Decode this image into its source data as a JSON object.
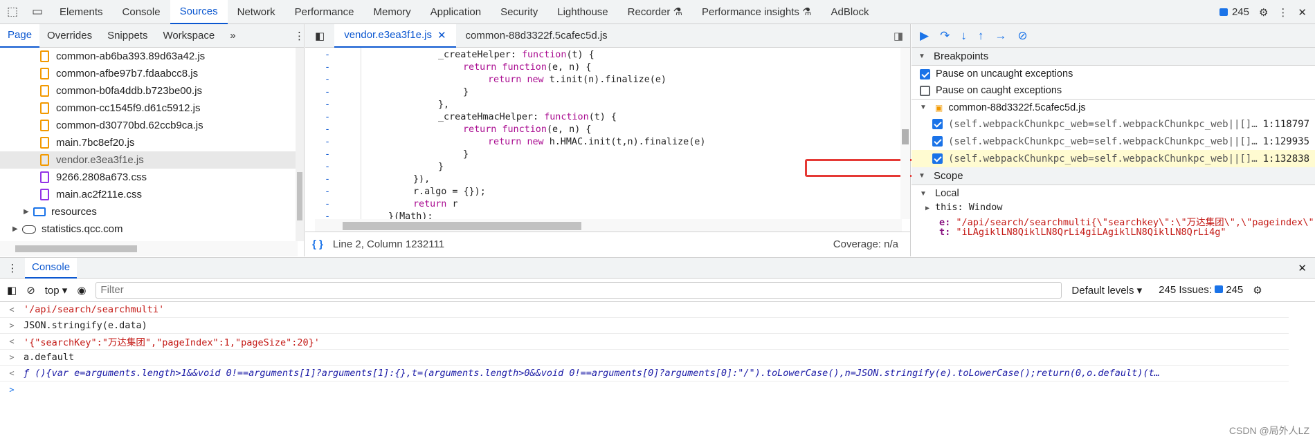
{
  "topbar": {
    "tabs": [
      "Elements",
      "Console",
      "Sources",
      "Network",
      "Performance",
      "Memory",
      "Application",
      "Security",
      "Lighthouse",
      "Recorder ⚗",
      "Performance insights ⚗",
      "AdBlock"
    ],
    "active_tab": "Sources",
    "issues_count": "245"
  },
  "navigator": {
    "subtabs": [
      "Page",
      "Overrides",
      "Snippets",
      "Workspace"
    ],
    "files": [
      {
        "name": "common-ab6ba393.89d63a42.js",
        "type": "js"
      },
      {
        "name": "common-afbe97b7.fdaabcc8.js",
        "type": "js"
      },
      {
        "name": "common-b0fa4ddb.b723be00.js",
        "type": "js"
      },
      {
        "name": "common-cc1545f9.d61c5912.js",
        "type": "js"
      },
      {
        "name": "common-d30770bd.62ccb9ca.js",
        "type": "js"
      },
      {
        "name": "main.7bc8ef20.js",
        "type": "js"
      },
      {
        "name": "vendor.e3ea3f1e.js",
        "type": "js",
        "selected": true
      },
      {
        "name": "9266.2808a673.css",
        "type": "css"
      },
      {
        "name": "main.ac2f211e.css",
        "type": "css"
      }
    ],
    "folder_resources": "resources",
    "domain_statistics": "statistics.qcc.com"
  },
  "editor": {
    "tabs": [
      {
        "label": "vendor.e3ea3f1e.js",
        "active": true
      },
      {
        "label": "common-88d3322f.5cafec5d.js",
        "active": false
      }
    ],
    "lines": [
      {
        "gut": "-",
        "ind": 8,
        "parts": [
          [
            "_createHelper: ",
            "fn"
          ],
          [
            "function",
            "kw"
          ],
          [
            "(t) {",
            "fn"
          ]
        ]
      },
      {
        "gut": "-",
        "ind": 12,
        "parts": [
          [
            "return ",
            "kw"
          ],
          [
            "function",
            "kw"
          ],
          [
            "(e, n) {",
            "fn"
          ]
        ]
      },
      {
        "gut": "-",
        "ind": 16,
        "parts": [
          [
            "return ",
            "kw"
          ],
          [
            "new ",
            "kw"
          ],
          [
            "t.init(n).finalize(e)",
            "fn"
          ]
        ]
      },
      {
        "gut": "-",
        "ind": 12,
        "parts": [
          [
            "}",
            "fn"
          ]
        ]
      },
      {
        "gut": "-",
        "ind": 8,
        "parts": [
          [
            "},",
            "fn"
          ]
        ]
      },
      {
        "gut": "-",
        "ind": 8,
        "parts": [
          [
            "_createHmacHelper: ",
            "fn"
          ],
          [
            "function",
            "kw"
          ],
          [
            "(t) {",
            "fn"
          ]
        ]
      },
      {
        "gut": "-",
        "ind": 12,
        "parts": [
          [
            "return ",
            "kw"
          ],
          [
            "function",
            "kw"
          ],
          [
            "(e, n) {",
            "fn"
          ]
        ]
      },
      {
        "gut": "-",
        "ind": 16,
        "parts": [
          [
            "return ",
            "kw"
          ],
          [
            "new ",
            "kw"
          ],
          [
            "h.HMAC.init(t,n).finalize(e)",
            "fn"
          ]
        ]
      },
      {
        "gut": "-",
        "ind": 12,
        "parts": [
          [
            "}",
            "fn"
          ]
        ]
      },
      {
        "gut": "-",
        "ind": 8,
        "parts": [
          [
            "}",
            "fn"
          ]
        ]
      },
      {
        "gut": "-",
        "ind": 4,
        "parts": [
          [
            "}),",
            "fn"
          ]
        ]
      },
      {
        "gut": "-",
        "ind": 4,
        "parts": [
          [
            "r.algo = {});",
            "fn"
          ]
        ]
      },
      {
        "gut": "-",
        "ind": 4,
        "parts": [
          [
            "return ",
            "kw"
          ],
          [
            "r",
            "fn"
          ]
        ]
      },
      {
        "gut": "-",
        "ind": 0,
        "parts": [
          [
            "}(Math);",
            "fn"
          ]
        ]
      }
    ],
    "status_position": "Line 2, Column 1232111",
    "status_coverage": "Coverage: n/a"
  },
  "debugger": {
    "breakpoints_title": "Breakpoints",
    "pause_uncaught": "Pause on uncaught exceptions",
    "pause_caught": "Pause on caught exceptions",
    "bp_file": "common-88d3322f.5cafec5d.js",
    "breakpoints": [
      {
        "code": "(self.webpackChunkpc_web=self.webpackChunkpc_web||[]…",
        "line": "1:118797",
        "hl": false
      },
      {
        "code": "(self.webpackChunkpc_web=self.webpackChunkpc_web||[]…",
        "line": "1:129935",
        "hl": false
      },
      {
        "code": "(self.webpackChunkpc_web=self.webpackChunkpc_web||[]…",
        "line": "1:132838",
        "hl": true
      }
    ],
    "scope_title": "Scope",
    "local_title": "Local",
    "this_label": "this:",
    "this_value": "Window",
    "var_e_name": "e:",
    "var_e_value": "\"/api/search/searchmulti{\\\"searchkey\\\":\\\"万达集团\\\",\\\"pageindex\\\"",
    "var_t_name": "t:",
    "var_t_value": "\"iLAgiklLN8QiklLN8QrLi4giLAgiklLN8QiklLN8QrLi4g\""
  },
  "console": {
    "title": "Console",
    "context": "top",
    "filter_placeholder": "Filter",
    "levels": "Default levels ▾",
    "issues_label": "245 Issues:",
    "issues_count": "245",
    "rows": [
      {
        "dir": "out",
        "text": "'/api/search/searchmulti'",
        "cls": "str"
      },
      {
        "dir": "in",
        "text": "JSON.stringify(e.data)",
        "cls": "fnsig"
      },
      {
        "dir": "out",
        "text": "'{\"searchKey\":\"万达集团\",\"pageIndex\":1,\"pageSize\":20}'",
        "cls": "str"
      },
      {
        "dir": "in",
        "text": "a.default",
        "cls": "fnsig"
      },
      {
        "dir": "out",
        "text": "ƒ (){var e=arguments.length>1&&void 0!==arguments[1]?arguments[1]:{},t=(arguments.length>0&&void 0!==arguments[0]?arguments[0]:\"/\").toLowerCase(),n=JSON.stringify(e).toLowerCase();return(0,o.default)(t…",
        "cls": "ital"
      }
    ]
  },
  "watermark": "CSDN @局外人LZ"
}
